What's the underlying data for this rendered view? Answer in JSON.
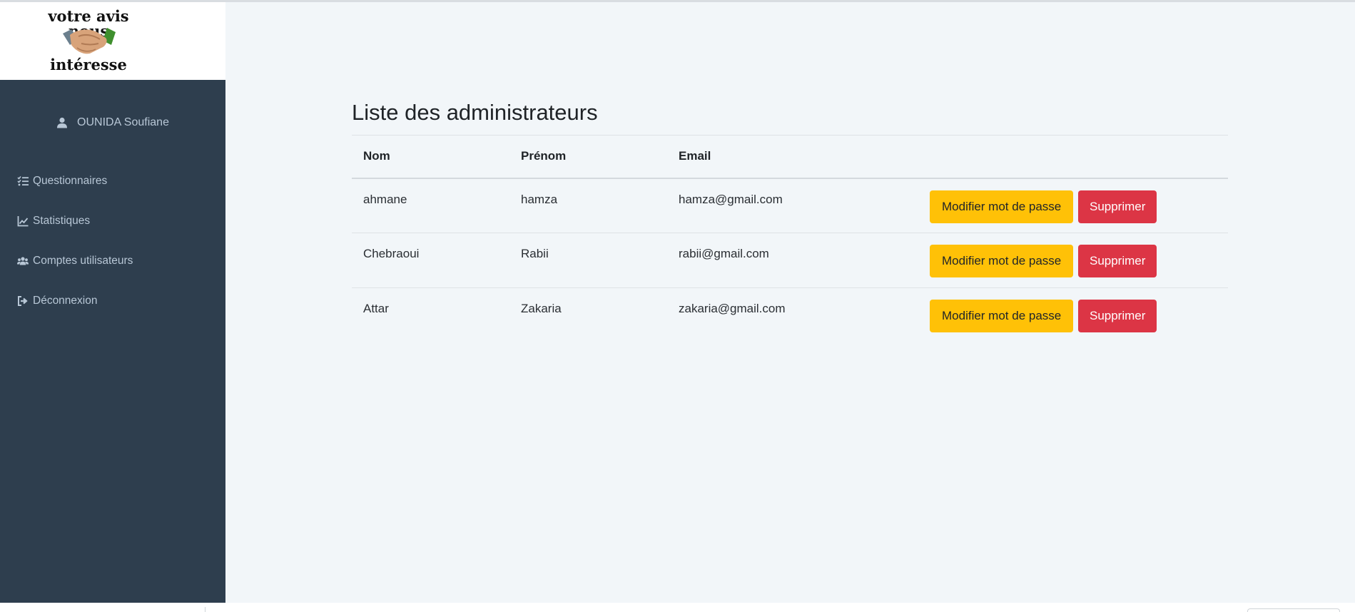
{
  "logo": {
    "line1": "votre avis nous",
    "line2": "intéresse"
  },
  "sidebar": {
    "user": {
      "name": "OUNIDA Soufiane",
      "icon": "user-icon"
    },
    "items": [
      {
        "label": "Questionnaires",
        "icon": "list-check-icon"
      },
      {
        "label": "Statistiques",
        "icon": "chart-line-icon"
      },
      {
        "label": "Comptes utilisateurs",
        "icon": "users-icon"
      },
      {
        "label": "Déconnexion",
        "icon": "sign-out-icon"
      }
    ]
  },
  "main": {
    "title": "Liste des administrateurs",
    "table": {
      "headers": [
        "Nom",
        "Prénom",
        "Email",
        ""
      ],
      "rows": [
        {
          "nom": "ahmane",
          "prenom": "hamza",
          "email": "hamza@gmail.com"
        },
        {
          "nom": "Chebraoui",
          "prenom": "Rabii",
          "email": "rabii@gmail.com"
        },
        {
          "nom": "Attar",
          "prenom": "Zakaria",
          "email": "zakaria@gmail.com"
        }
      ],
      "action_edit_label": "Modifier mot de passe",
      "action_delete_label": "Supprimer"
    }
  },
  "colors": {
    "sidebar_bg": "#2e3e4e",
    "sidebar_text": "#b8c7d6",
    "page_bg": "#f2f6f9",
    "warning": "#ffc107",
    "danger": "#dc3545"
  }
}
